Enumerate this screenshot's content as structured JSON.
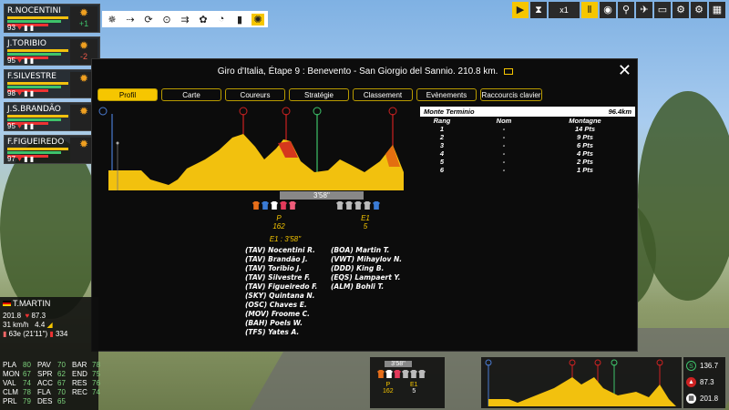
{
  "riders": [
    {
      "name": "R.NOCENTINI",
      "num": "93",
      "delta": "+1",
      "positive": true
    },
    {
      "name": "J.TORIBIO",
      "num": "95",
      "delta": "-2",
      "positive": false
    },
    {
      "name": "F.SILVESTRE",
      "num": "98",
      "delta": "",
      "positive": false
    },
    {
      "name": "J.S.BRANDÃO",
      "num": "95",
      "delta": "",
      "positive": false
    },
    {
      "name": "F.FIGUEIREDO",
      "num": "97",
      "delta": "",
      "positive": false
    }
  ],
  "modal": {
    "title": "Giro d'Italia, Étape 9 : Benevento - San Giorgio del Sannio. 210.8 km.",
    "tabs": [
      "Profil",
      "Carte",
      "Coureurs",
      "Stratégie",
      "Classement",
      "Evènements",
      "Raccourcis clavier"
    ]
  },
  "mountain": {
    "name": "Monte Terminio",
    "km": "96.4km",
    "cols": [
      "Rang",
      "Nom",
      "Montagne"
    ],
    "rows": [
      [
        "1",
        "-",
        "14 Pts"
      ],
      [
        "2",
        "-",
        "9 Pts"
      ],
      [
        "3",
        "-",
        "6 Pts"
      ],
      [
        "4",
        "-",
        "4 Pts"
      ],
      [
        "5",
        "-",
        "2 Pts"
      ],
      [
        "6",
        "-",
        "1 Pts"
      ]
    ]
  },
  "race": {
    "gap": "3'58''",
    "peloton_label": "P",
    "peloton_count": "162",
    "e1_label": "E1",
    "e1_count": "5",
    "e1_gap": "E1 : 3'58''",
    "peloton_riders": [
      "(TAV) Nocentini R.",
      "(TAV) Brandão J.",
      "(TAV) Toribio J.",
      "(TAV) Silvestre F.",
      "(TAV) Figueiredo F.",
      "(SKY) Quintana N.",
      "(OSC) Chaves E.",
      "(MOV) Froome C.",
      "(BAH) Poels W.",
      "(TFS) Yates A."
    ],
    "breakaway_riders": [
      "(BOA) Martin T.",
      "(VWT) Mihaylov N.",
      "(DDD) King B.",
      "(EQS) Lampaert Y.",
      "(ALM) Bohli T."
    ]
  },
  "player": {
    "name": "T.MARTIN",
    "distance": "201.8",
    "km": "87.3",
    "speed": "31",
    "speed_unit": "km/h",
    "slope": "4.4",
    "rank": "63e (21'11\")",
    "other": "334",
    "stats": [
      [
        "PLA",
        "80",
        "PAV",
        "70",
        "BAR",
        "78"
      ],
      [
        "MON",
        "67",
        "SPR",
        "62",
        "END",
        "75"
      ],
      [
        "VAL",
        "74",
        "ACC",
        "67",
        "RES",
        "76"
      ],
      [
        "CLM",
        "78",
        "FLA",
        "70",
        "REC",
        "74"
      ],
      [
        "PRL",
        "79",
        "DES",
        "65",
        "",
        ""
      ]
    ]
  },
  "mini": {
    "gap": "3'58''",
    "p": "P",
    "p_count": "162",
    "e1": "E1",
    "e1_count": "5",
    "remaining": "136.7",
    "done": "87.3",
    "total": "201.8"
  },
  "topbar": {
    "time": "x1"
  }
}
